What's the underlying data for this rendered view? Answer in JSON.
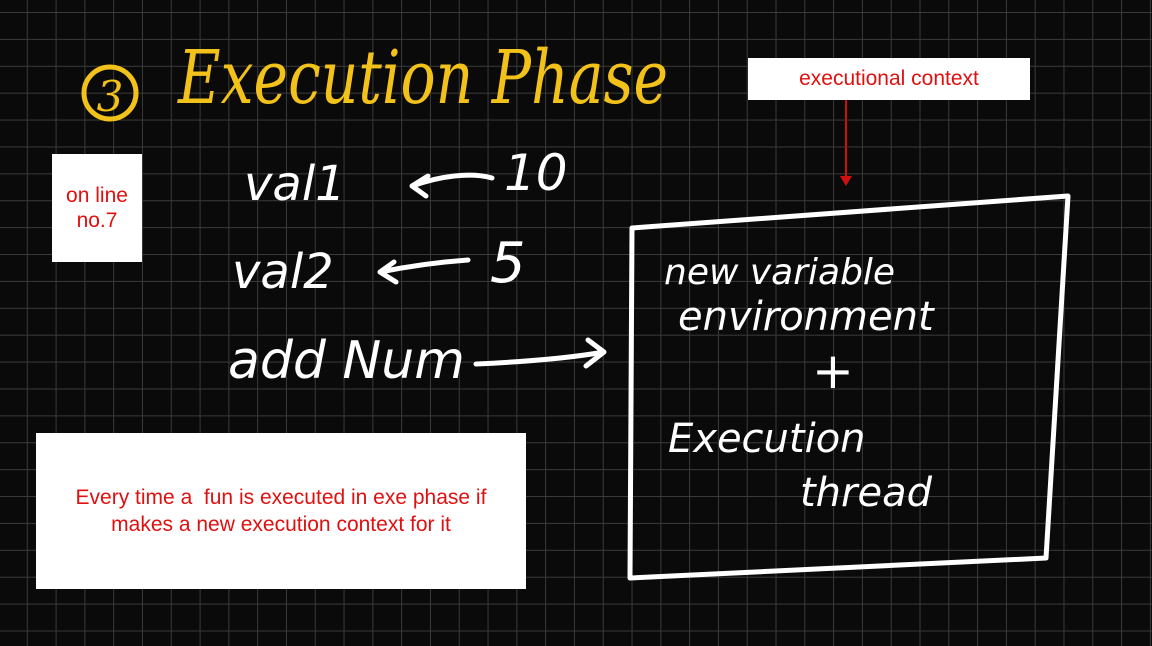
{
  "title": {
    "number": "3",
    "text": "Execution Phase"
  },
  "assignments": [
    {
      "name": "val1",
      "value": "10"
    },
    {
      "name": "val2",
      "value": "5"
    },
    {
      "name": "add Num",
      "value": ""
    }
  ],
  "context_box": {
    "line1": "new variable",
    "line2": "environment",
    "plus": "+",
    "line3": "Execution",
    "line4": "thread"
  },
  "notes": {
    "context_label": "executional context",
    "line_label_1": "on line",
    "line_label_2": "no.7",
    "explanation_1": "Every time a  fun is executed in exe phase if",
    "explanation_2": "makes a new execution context for it"
  },
  "colors": {
    "board": "#0a0a0a",
    "grid": "#3a3a3a",
    "chalk": "#ffffff",
    "title": "#f2c21b",
    "note_text": "#e01010",
    "pointer": "#d01010"
  }
}
